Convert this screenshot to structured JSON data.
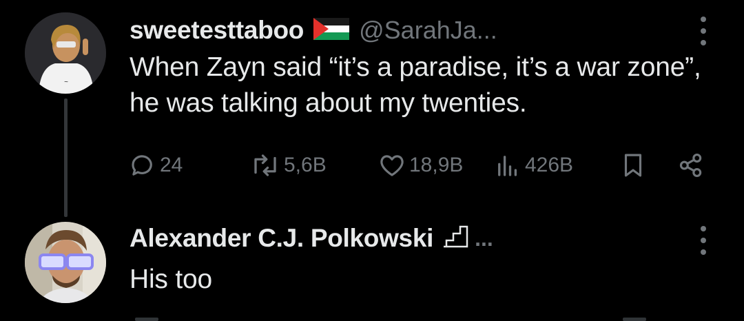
{
  "tweet": {
    "display_name": "sweetesttaboo",
    "flag_icon": "palestine-flag-icon",
    "handle": "@SarahJa...",
    "text": "When Zayn said “it’s a paradise, it’s a war zone”, he was talking about my twenties.",
    "actions": {
      "replies": "24",
      "reposts": "5,6B",
      "likes": "18,9B",
      "views": "426B"
    }
  },
  "reply": {
    "display_name": "Alexander C.J. Polkowski",
    "badge_icon": "staircase-icon",
    "ellipsis": "...",
    "text": "His too"
  },
  "colors": {
    "background": "#000000",
    "primary_text": "#e7e9ea",
    "secondary_text": "#71767b",
    "thread_line": "#333639"
  }
}
